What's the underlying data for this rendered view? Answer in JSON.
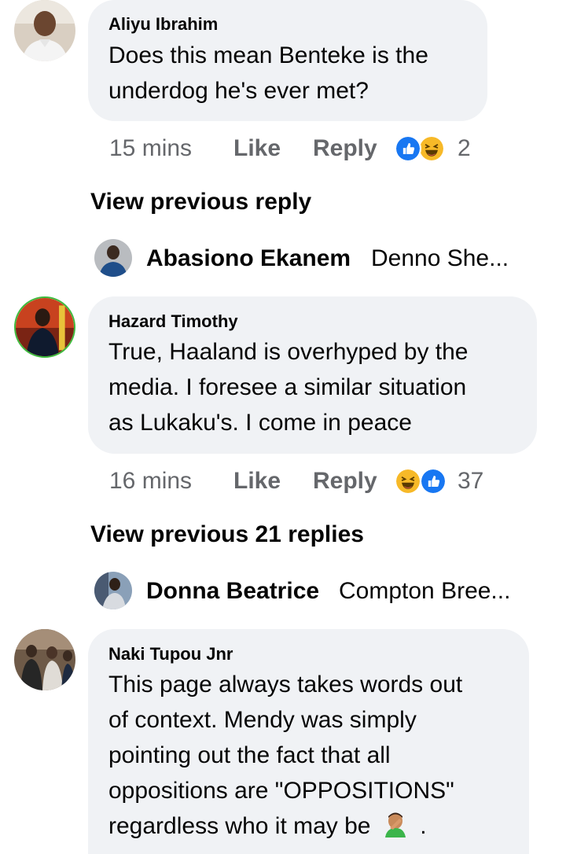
{
  "comments": [
    {
      "author": "Aliyu Ibrahim",
      "lines": [
        "Does this mean Benteke is the",
        "underdog he's ever met?"
      ],
      "time": "15 mins",
      "like_label": "Like",
      "reply_label": "Reply",
      "reaction_icons": [
        "like-icon",
        "haha-icon"
      ],
      "reaction_count": "2"
    },
    {
      "author": "Hazard Timothy",
      "lines": [
        "True, Haaland is overhyped by the",
        "media. I foresee a similar situation",
        "as Lukaku's. I come in peace"
      ],
      "time": "16 mins",
      "like_label": "Like",
      "reply_label": "Reply",
      "reaction_icons": [
        "haha-icon",
        "like-icon"
      ],
      "reaction_count": "37"
    },
    {
      "author": "Naki Tupou Jnr",
      "lines": [
        "This page always takes words out",
        "of context. Mendy was simply",
        "pointing out the fact that all",
        "oppositions are \"OPPOSITIONS\"",
        "regardless who it may be"
      ],
      "end_emoji": "man-facepalming-emoji",
      "end_text": "."
    }
  ],
  "threads": [
    {
      "view_previous_label": "View previous reply",
      "reply_author": "Abasiono Ekanem",
      "reply_preview": "Denno She..."
    },
    {
      "view_previous_label": "View previous 21 replies",
      "reply_author": "Donna Beatrice",
      "reply_preview": "Compton Bree..."
    }
  ],
  "colors": {
    "bubble": "#f0f2f5",
    "meta_text": "#65676b",
    "like_blue": "#1877f2",
    "haha_yellow": "#f7b928"
  }
}
